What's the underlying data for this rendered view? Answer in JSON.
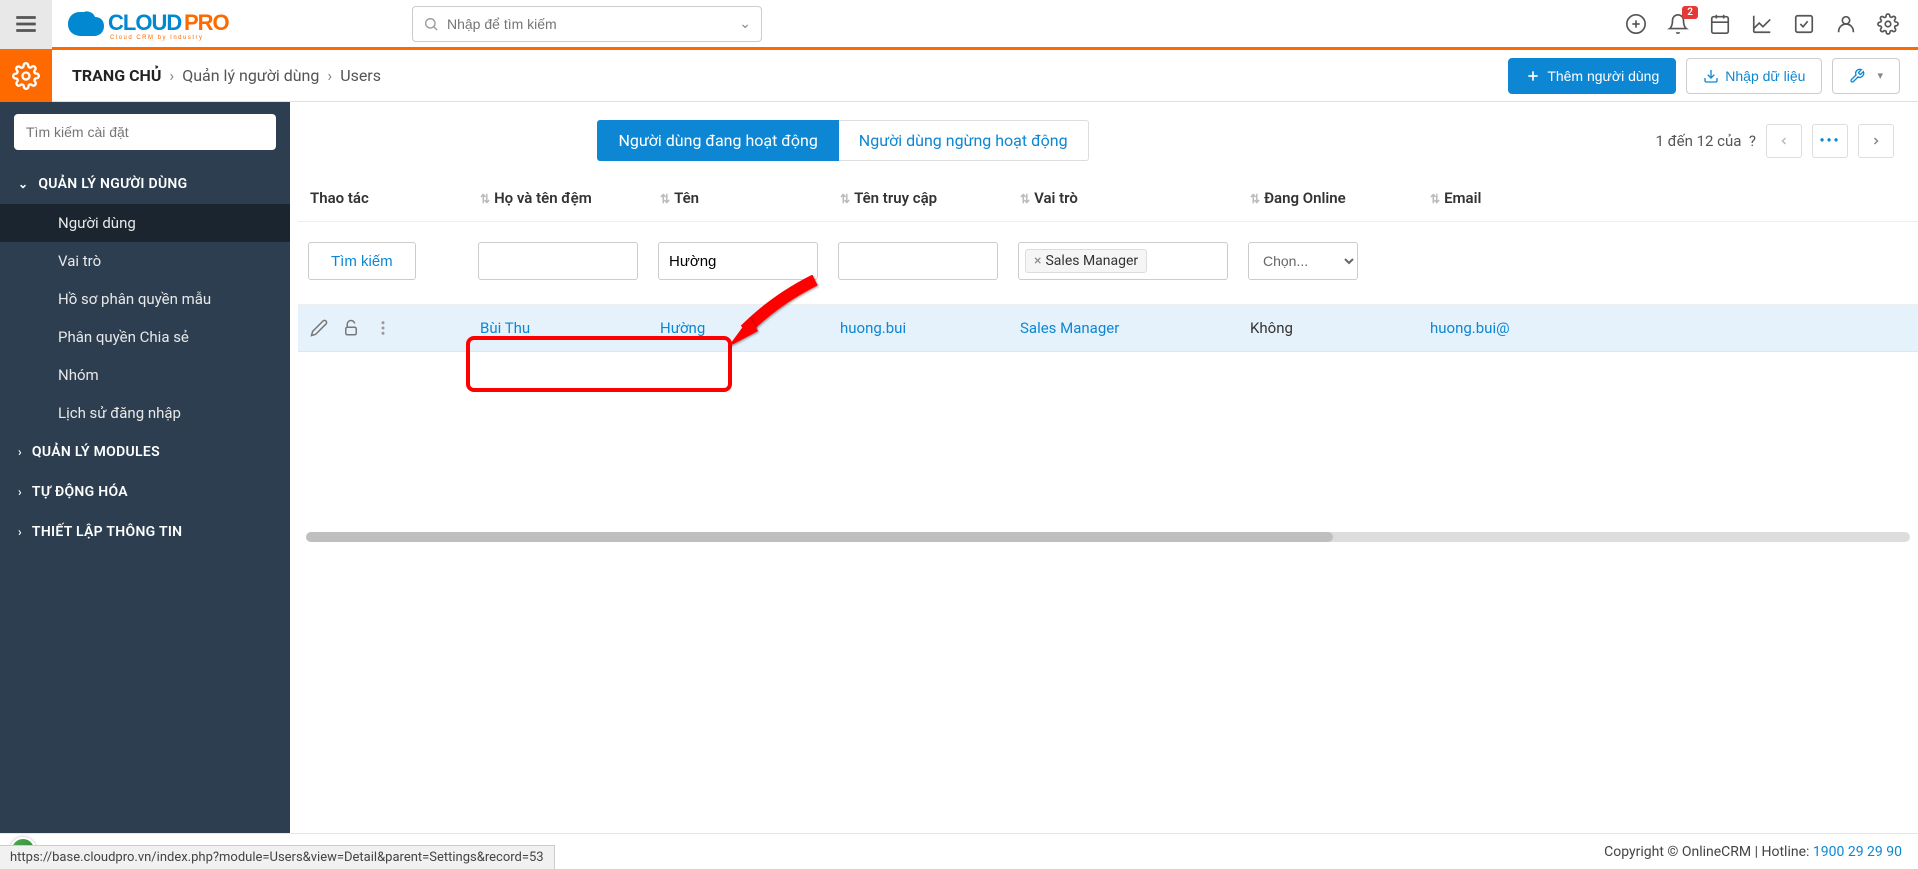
{
  "header": {
    "search_placeholder": "Nhập để tìm kiếm",
    "notification_count": "2"
  },
  "breadcrumb": {
    "home": "TRANG CHỦ",
    "level1": "Quản lý người dùng",
    "level2": "Users",
    "add_user": "Thêm người dùng",
    "import": "Nhập dữ liệu"
  },
  "sidebar": {
    "search_placeholder": "Tìm kiếm cài đặt",
    "group_user_mgmt": "QUẢN LÝ NGƯỜI DÙNG",
    "items": {
      "users": "Người dùng",
      "roles": "Vai trò",
      "profiles": "Hồ sơ phân quyền mẫu",
      "sharing": "Phân quyền Chia sẻ",
      "groups": "Nhóm",
      "login_history": "Lịch sử đăng nhập"
    },
    "group_modules": "QUẢN LÝ MODULES",
    "group_automation": "TỰ ĐỘNG HÓA",
    "group_config": "THIẾT LẬP THÔNG TIN"
  },
  "tabs": {
    "active_users": "Người dùng đang hoạt động",
    "inactive_users": "Người dùng ngừng hoạt động"
  },
  "pager": {
    "text_prefix": "1 đến 12 của",
    "total": "?"
  },
  "table": {
    "headers": {
      "actions": "Thao tác",
      "lastname": "Họ và tên đệm",
      "firstname": "Tên",
      "username": "Tên truy cập",
      "role": "Vai trò",
      "online": "Đang Online",
      "email": "Email"
    },
    "filter": {
      "search_btn": "Tìm kiếm",
      "firstname_value": "Hường",
      "role_tag": "Sales Manager",
      "select_placeholder": "Chọn..."
    },
    "row": {
      "lastname": "Bùi Thu",
      "firstname": "Hường",
      "username": "huong.bui",
      "role": "Sales Manager",
      "online": "Không",
      "email": "huong.bui@"
    }
  },
  "footer": {
    "status_url": "https://base.cloudpro.vn/index.php?module=Users&view=Detail&parent=Settings&record=53",
    "copyright": "Copyright © OnlineCRM | Hotline: ",
    "hotline": "1900 29 29 90"
  }
}
